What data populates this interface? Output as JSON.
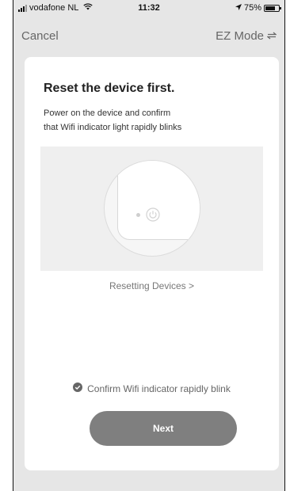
{
  "status_bar": {
    "carrier": "vodafone NL",
    "time": "11:32",
    "battery": "75%",
    "battery_level": 0.75
  },
  "nav": {
    "cancel_label": "Cancel",
    "mode_label": "EZ Mode"
  },
  "card": {
    "title": "Reset the device first.",
    "description_line1": "Power on the device and confirm",
    "description_line2": "that Wifi indicator light rapidly blinks",
    "resetting_link": "Resetting Devices >",
    "confirm_text": "Confirm Wifi indicator rapidly blink",
    "next_label": "Next"
  },
  "colors": {
    "background": "#e6e6e6",
    "card": "#ffffff",
    "button": "#7f7f7f",
    "muted_text": "#666666"
  },
  "icons": [
    "signal-icon",
    "wifi-icon",
    "location-arrow-icon",
    "battery-icon",
    "switch-arrows-icon",
    "power-icon",
    "check-circle-icon"
  ]
}
